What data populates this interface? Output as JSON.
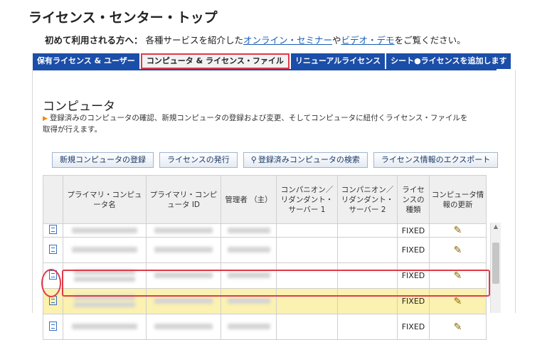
{
  "page": {
    "title": "ライセンス・センター・トップ"
  },
  "intro": {
    "bold": "初めて利用される方へ：",
    "text_before": "各種サービスを紹介した",
    "link1": "オンライン・セミナー",
    "mid": "や",
    "link2": "ビデオ・デモ",
    "text_after": "をご覧ください。"
  },
  "tabs": [
    {
      "label": "保有ライセンス & ユーザー"
    },
    {
      "label": "コンピュータ & ライセンス・ファイル"
    },
    {
      "label": "リニューアルライセンス"
    },
    {
      "label": "シート●ライセンスを追加します"
    }
  ],
  "section": {
    "title": "コンピュータ",
    "description": "登録済みのコンピュータの確認、新規コンピュータの登録および変更、そしてコンピュータに紐付くライセンス・ファイルを取得が行えます。"
  },
  "buttons": {
    "register": "新規コンピュータの登録",
    "issue": "ライセンスの発行",
    "search": "登録済みコンピュータの検索",
    "export": "ライセンス情報のエクスポート"
  },
  "table": {
    "headers": [
      "",
      "プライマリ・コンピュータ名",
      "プライマリ・コンピュータ ID",
      "管理者 （主）",
      "コンパニオン／リダンダント・サーバー 1",
      "コンパニオン／リダンダント・サーバー 2",
      "ライセンスの種類",
      "コンピュータ情報の更新"
    ],
    "rows": [
      {
        "type": "FIXED"
      },
      {
        "type": "FIXED"
      },
      {
        "type": "FIXED"
      },
      {
        "type": "FIXED"
      },
      {
        "type": "FIXED"
      }
    ]
  },
  "icons": {
    "row_doc": "document-icon",
    "edit": "pencil-icon",
    "search": "magnifier-icon"
  },
  "colors": {
    "tab_bg": "#1b4ea8",
    "highlight": "#e03a4a",
    "row_highlight": "#fbf1b0",
    "link": "#1a5fb4"
  }
}
